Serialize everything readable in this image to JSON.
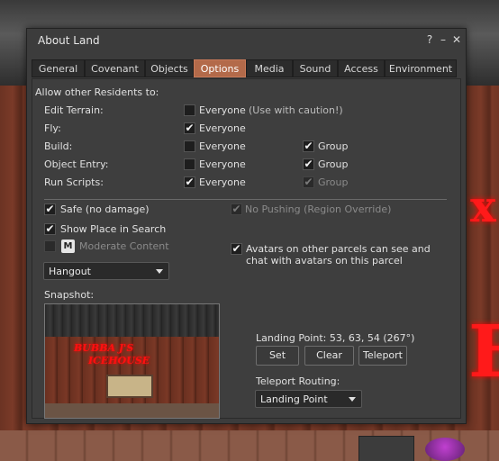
{
  "window": {
    "title": "About Land",
    "help_label": "?",
    "minimize_label": "–",
    "close_label": "✕"
  },
  "tabs": [
    {
      "label": "General"
    },
    {
      "label": "Covenant"
    },
    {
      "label": "Objects"
    },
    {
      "label": "Options",
      "active": true
    },
    {
      "label": "Media"
    },
    {
      "label": "Sound"
    },
    {
      "label": "Access"
    },
    {
      "label": "Environment"
    }
  ],
  "options": {
    "allow_header": "Allow other Residents to:",
    "edit_terrain": {
      "label": "Edit Terrain:",
      "everyone_label": "Everyone",
      "everyone_checked": false,
      "caution": "(Use with caution!)"
    },
    "fly": {
      "label": "Fly:",
      "everyone_label": "Everyone",
      "everyone_checked": true
    },
    "build": {
      "label": "Build:",
      "everyone_label": "Everyone",
      "everyone_checked": false,
      "group_label": "Group",
      "group_checked": true
    },
    "object_entry": {
      "label": "Object Entry:",
      "everyone_label": "Everyone",
      "everyone_checked": false,
      "group_label": "Group",
      "group_checked": true
    },
    "run_scripts": {
      "label": "Run Scripts:",
      "everyone_label": "Everyone",
      "everyone_checked": true,
      "group_label": "Group",
      "group_checked": true,
      "group_disabled": true
    },
    "safe": {
      "label": "Safe (no damage)",
      "checked": true
    },
    "show_place": {
      "label": "Show Place in Search",
      "checked": true
    },
    "moderate": {
      "badge": "M",
      "label": "Moderate Content",
      "checked": false,
      "disabled": true
    },
    "no_pushing": {
      "label": "No Pushing (Region Override)",
      "checked": true,
      "disabled": true
    },
    "avatars_see": {
      "label_line1": "Avatars on other parcels can see and",
      "label_line2": "chat with avatars on this parcel",
      "checked": true
    },
    "category": {
      "value": "Hangout"
    },
    "snapshot_label": "Snapshot:",
    "snapshot_sign_line1": "BUBBA J'S",
    "snapshot_sign_line2": "ICEHOUSE",
    "landing_point": "Landing Point: 53, 63, 54 (267°)",
    "set_button": "Set",
    "clear_button": "Clear",
    "teleport_button": "Teleport",
    "teleport_routing_label": "Teleport Routing:",
    "teleport_routing": {
      "value": "Landing Point"
    }
  },
  "check_glyph": "✔",
  "colors": {
    "active_tab": "#b36a4a",
    "panel": "#3e3e3e"
  }
}
